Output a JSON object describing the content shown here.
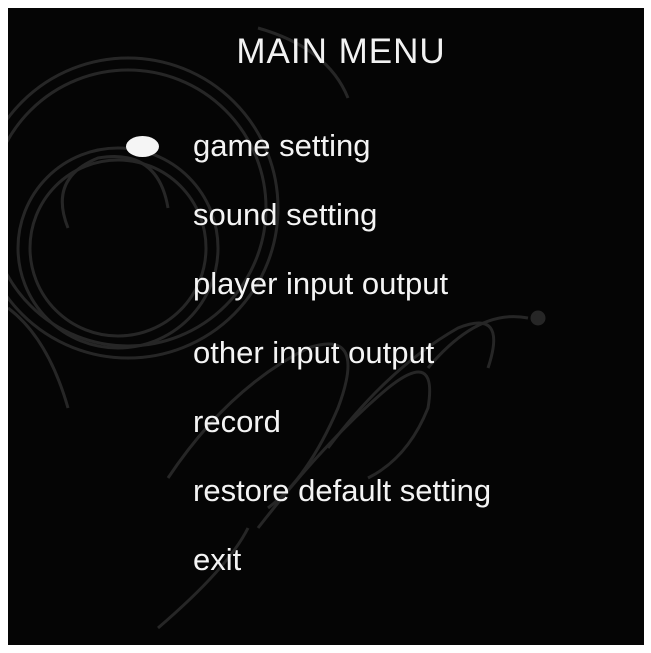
{
  "menu": {
    "title": "MAIN MENU",
    "selected_index": 0,
    "items": [
      {
        "label": "game setting"
      },
      {
        "label": "sound setting"
      },
      {
        "label": "player input output"
      },
      {
        "label": "other input output"
      },
      {
        "label": "record"
      },
      {
        "label": "restore default setting"
      },
      {
        "label": "exit"
      }
    ]
  },
  "cursor_icon": "oval-selector-icon",
  "colors": {
    "background": "#050505",
    "text": "#f4f4f4",
    "frame": "#ffffff"
  }
}
